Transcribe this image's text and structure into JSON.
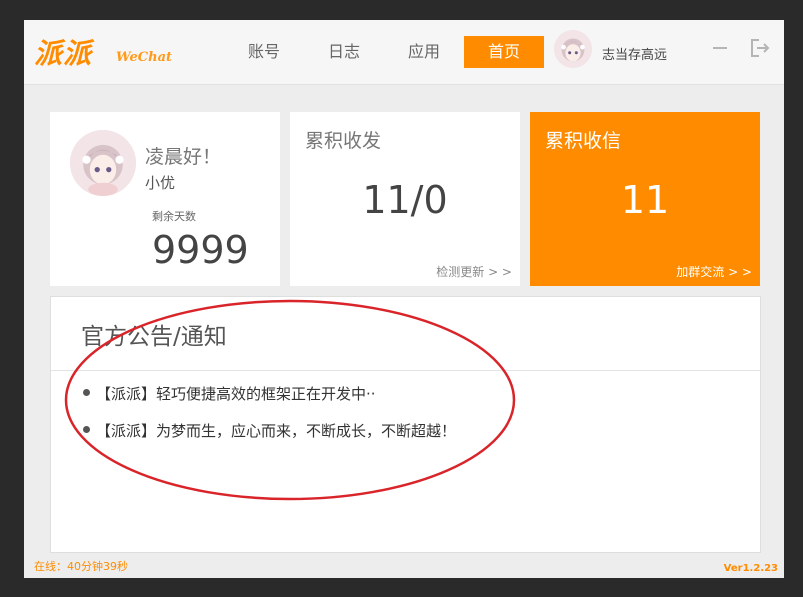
{
  "app": {
    "logo_text": "派派",
    "logo_sub": "WeChat"
  },
  "nav": {
    "tabs": [
      {
        "label": "账号"
      },
      {
        "label": "日志"
      },
      {
        "label": "应用"
      },
      {
        "label": "首页",
        "active": true
      }
    ]
  },
  "user": {
    "display_name": "志当存高远",
    "avatar_icon": "anime-girl-avatar"
  },
  "window_controls": {
    "minimize_icon": "minimize-icon",
    "exit_icon": "exit-icon"
  },
  "welcome_card": {
    "greeting": "凌晨好！",
    "name": "小优",
    "days_label": "剩余天数",
    "days_value": "9999"
  },
  "sent_card": {
    "title": "累积收发",
    "value": "11/0",
    "link": "检测更新 > >"
  },
  "received_card": {
    "title": "累积收信",
    "value": "11",
    "link": "加群交流 > >"
  },
  "notice": {
    "title": "官方公告/通知",
    "items": [
      "【派派】轻巧便捷高效的框架正在开发中··",
      "【派派】为梦而生，应心而来，不断成长，不断超越！"
    ]
  },
  "status": {
    "online": "在线：40分钟39秒",
    "version": "Ver1.2.23"
  },
  "colors": {
    "accent": "#ff8c00",
    "annotation": "#d9242a"
  }
}
